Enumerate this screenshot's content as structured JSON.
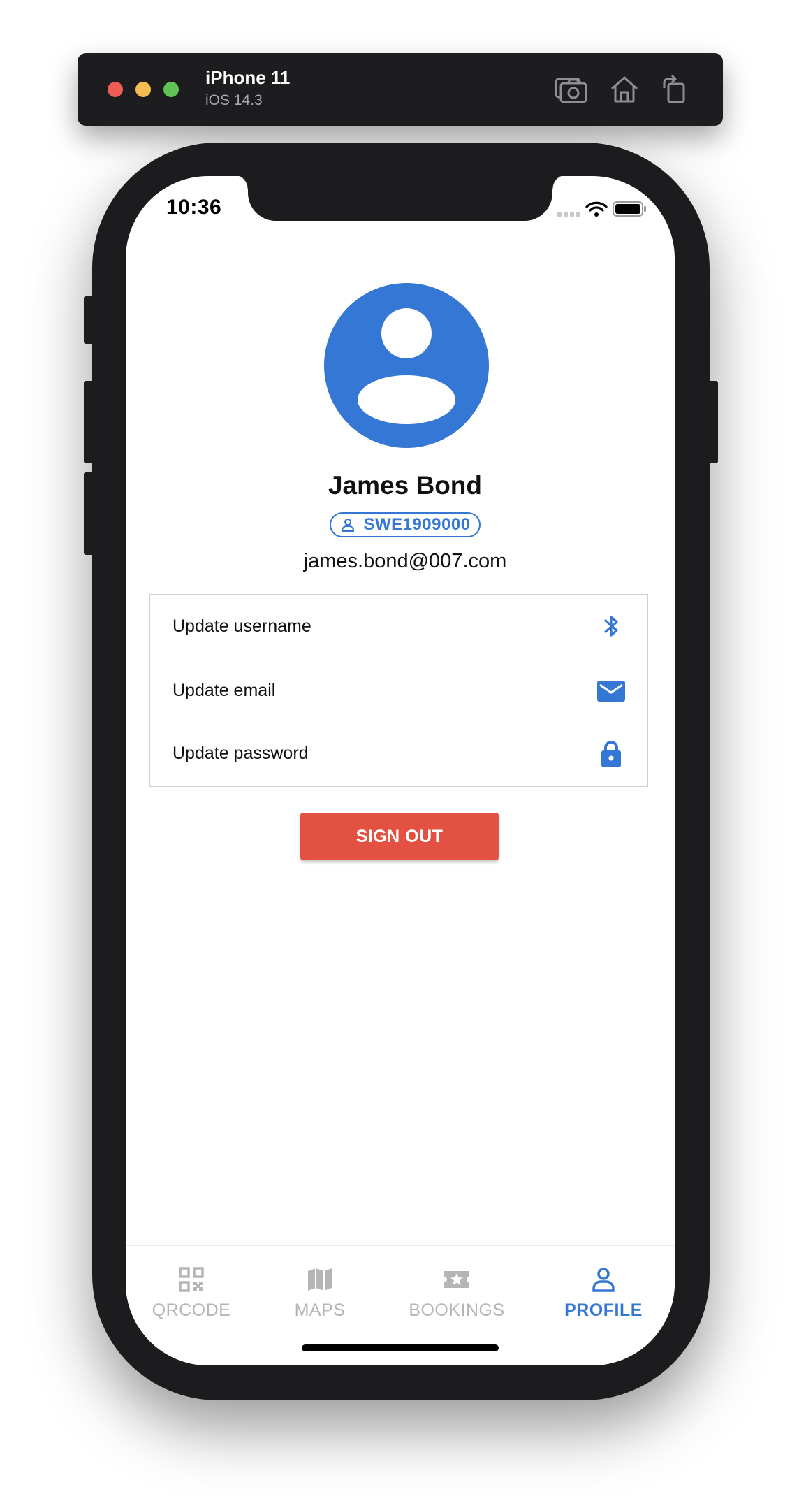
{
  "simulator": {
    "device": "iPhone 11",
    "os": "iOS 14.3",
    "icons": [
      "screenshot-icon",
      "home-icon",
      "rotate-icon"
    ]
  },
  "status_bar": {
    "time": "10:36",
    "icons": [
      "cellular-icon",
      "wifi-icon",
      "battery-icon"
    ]
  },
  "profile": {
    "name": "James Bond",
    "user_id": "SWE1909000",
    "email": "james.bond@007.com"
  },
  "settings": [
    {
      "label": "Update username",
      "icon": "bluetooth-icon"
    },
    {
      "label": "Update email",
      "icon": "mail-icon"
    },
    {
      "label": "Update password",
      "icon": "lock-icon"
    }
  ],
  "actions": {
    "sign_out_label": "SIGN OUT"
  },
  "tabs": [
    {
      "label": "QRCODE",
      "icon": "qrcode-icon",
      "active": false
    },
    {
      "label": "MAPS",
      "icon": "map-icon",
      "active": false
    },
    {
      "label": "BOOKINGS",
      "icon": "ticket-icon",
      "active": false
    },
    {
      "label": "PROFILE",
      "icon": "person-icon",
      "active": true
    }
  ],
  "colors": {
    "accent": "#3577d4",
    "danger": "#e25141",
    "inactive_tab": "#b5b5b5"
  }
}
